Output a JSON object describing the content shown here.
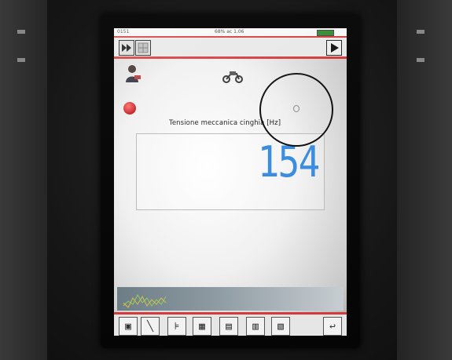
{
  "statusbar": {
    "left_text": "0151",
    "center_text": "68% ac 1.06",
    "battery_icon": "battery-icon"
  },
  "toolbar": {
    "fast_forward_icon": "fast-forward-icon",
    "grid_icon": "grid-icon",
    "play_icon": "play-icon"
  },
  "rider_icon": "rider-avatar-icon",
  "motorcycle_icon": "motorcycle-icon",
  "status_led_color": "#c01818",
  "measurement": {
    "label": "Tensione meccanica cinghia [Hz]",
    "value": "154",
    "value_color": "#3c8de0"
  },
  "bottom_toolbar": {
    "items": [
      {
        "icon": "monitor-icon",
        "glyph": "▣"
      },
      {
        "icon": "wrench-icon",
        "glyph": "╲"
      },
      {
        "icon": "sensor-icon",
        "glyph": "⊧"
      },
      {
        "icon": "data-grid-icon",
        "glyph": "▦"
      },
      {
        "icon": "table-icon",
        "glyph": "▤"
      },
      {
        "icon": "chart-icon",
        "glyph": "▥"
      },
      {
        "icon": "tools-icon",
        "glyph": "▧"
      },
      {
        "icon": "exit-icon",
        "glyph": "↩"
      }
    ]
  }
}
